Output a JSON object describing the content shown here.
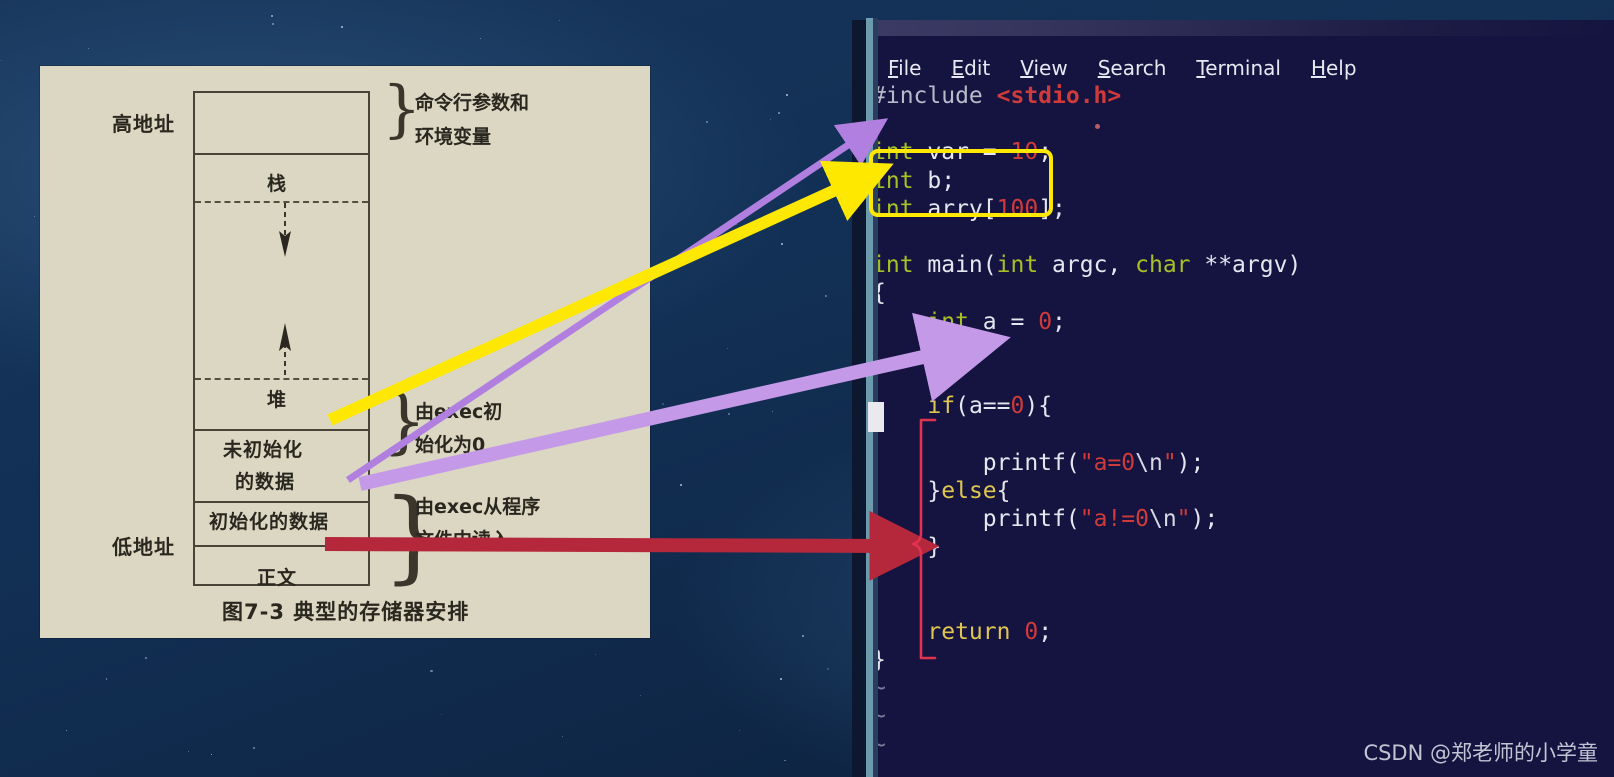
{
  "background": {
    "kind": "space-starfield",
    "color": "#123055"
  },
  "diagram": {
    "title": "图7-3  典型的存储器安排",
    "paper_color": "#dbd7c3",
    "ink_color": "#2a271f",
    "address_labels": {
      "high": "高地址",
      "low": "低地址"
    },
    "segments": [
      {
        "name": "args-env",
        "label": ""
      },
      {
        "name": "stack",
        "label": "栈"
      },
      {
        "name": "heap",
        "label": "堆"
      },
      {
        "name": "uninitialized-data",
        "label": "未初始化\n的数据",
        "line1": "未初始化",
        "line2": "的数据"
      },
      {
        "name": "initialized-data",
        "label": "初始化的数据"
      },
      {
        "name": "text",
        "label": "正文"
      }
    ],
    "side_notes": [
      {
        "name": "args-env-note",
        "line1": "命令行参数和",
        "line2": "环境变量"
      },
      {
        "name": "exec-zero-note",
        "line1": "由exec初",
        "line2": "始化为0"
      },
      {
        "name": "exec-file-note",
        "line1": "由exec从程序",
        "line2": "文件中读入"
      }
    ],
    "brace_glyph": "}"
  },
  "terminal": {
    "background_color": "#151440",
    "menu": [
      {
        "name": "file",
        "label": "File",
        "mnemonic": "F"
      },
      {
        "name": "edit",
        "label": "Edit",
        "mnemonic": "E"
      },
      {
        "name": "view",
        "label": "View",
        "mnemonic": "V"
      },
      {
        "name": "search",
        "label": "Search",
        "mnemonic": "S"
      },
      {
        "name": "terminal",
        "label": "Terminal",
        "mnemonic": "T"
      },
      {
        "name": "help",
        "label": "Help",
        "mnemonic": "H"
      }
    ],
    "editor": "vim",
    "code_lines": [
      "#include <stdio.h>",
      "",
      "int var = 10;",
      "int b;",
      "int arry[100];",
      "",
      "int main(int argc, char **argv)",
      "{",
      "    int a = 0;",
      "",
      "",
      "    if(a==0){",
      "",
      "        printf(\"a=0\\n\");",
      "    }else{",
      "        printf(\"a!=0\\n\");",
      "    }",
      "",
      "",
      "    return 0;",
      "}"
    ],
    "empty_line_marker": "~",
    "empty_line_count": 3,
    "cursor_visible": true
  },
  "annotations": {
    "yellow_highlight_box": {
      "color": "#ffe800",
      "targets": [
        "int b;",
        "int arry[100];"
      ]
    },
    "arrows": [
      {
        "name": "purple-arrow-uninitialized-to-var",
        "color": "#b07fe0",
        "from": "初始化的数据",
        "to": "int var = 10;"
      },
      {
        "name": "yellow-arrow-uninitialized-to-bss",
        "color": "#ffe800",
        "from": "未初始化的数据",
        "to": "int b; / int arry[100];"
      },
      {
        "name": "purple-arrow-initialized-to-local",
        "color": "#c49ae8",
        "from": "初始化的数据",
        "to": "int a = 0;"
      },
      {
        "name": "red-arrow-text-to-body",
        "color": "#b5283c",
        "from": "正文",
        "to": "函数体"
      }
    ],
    "red_brace": {
      "color": "#e0334f",
      "spans": "if(a==0){ ... return 0;"
    }
  },
  "watermark": {
    "text": "CSDN @郑老师的小学童"
  }
}
